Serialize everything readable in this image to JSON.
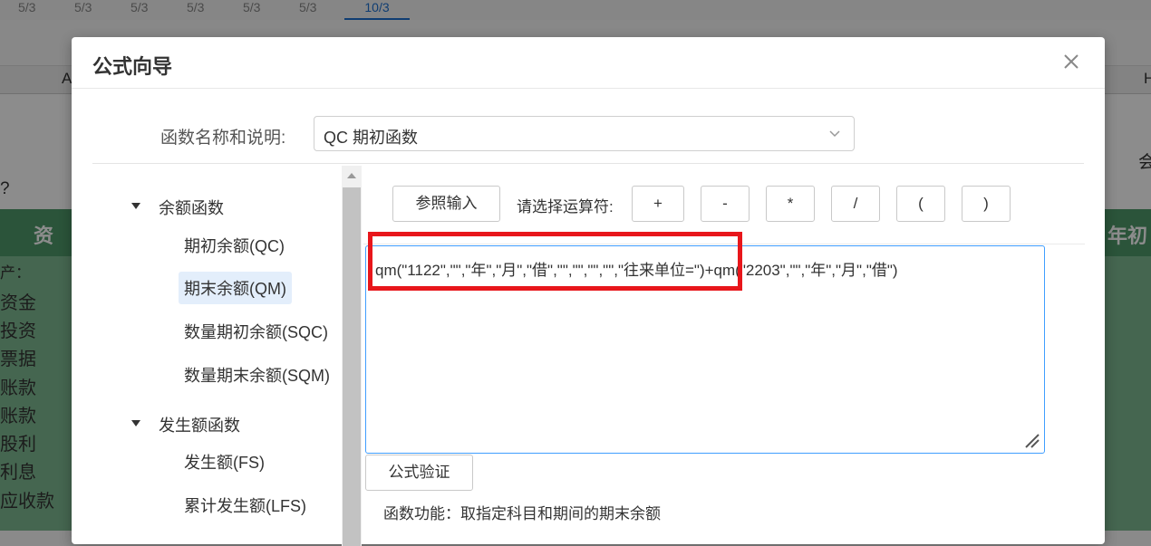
{
  "background": {
    "tabs": [
      "5/3",
      "5/3",
      "5/3",
      "5/3",
      "5/3",
      "5/3",
      "10/3"
    ],
    "column_letters": {
      "left": "A",
      "right": "H"
    },
    "question_mark": "?",
    "right_label": "会",
    "header_left": "资",
    "header_right": "年初",
    "row_labels": [
      "产：",
      "资金",
      "投资",
      "票据",
      "账款",
      "账款",
      "股利",
      "利息",
      "应收款"
    ]
  },
  "dialog": {
    "title": "公式向导",
    "function_label": "函数名称和说明:",
    "function_select_value": "QC 期初函数",
    "tree": {
      "groups": [
        {
          "label": "余额函数",
          "items": [
            "期初余额(QC)",
            "期末余额(QM)",
            "数量期初余额(SQC)",
            "数量期末余额(SQM)"
          ]
        },
        {
          "label": "发生额函数",
          "items": [
            "发生额(FS)",
            "累计发生额(LFS)"
          ]
        }
      ],
      "selected": "期末余额(QM)"
    },
    "reference_input_button": "参照输入",
    "operator_label": "请选择运算符:",
    "operators": [
      "+",
      "-",
      "*",
      "/",
      "(",
      ")"
    ],
    "formula": "qm(\"1122\",\"\",\"年\",\"月\",\"借\",\"\",\"\",\"\",\"\",\"往来单位=\")+qm(\"2203\",\"\",\"年\",\"月\",\"借\")",
    "verify_button": "公式验证",
    "function_description": "函数功能：取指定科目和期间的期末余额"
  },
  "colors": {
    "highlight": "#e8161b",
    "accent": "#409eff",
    "selected_bg": "#e3eefb"
  }
}
